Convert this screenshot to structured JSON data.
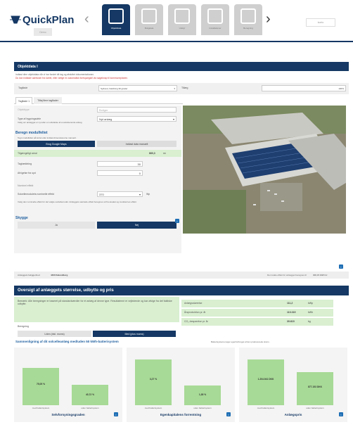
{
  "app": {
    "logo": "QuickPlan",
    "demo_button": "Demo",
    "account_label": "konto"
  },
  "steps": [
    {
      "label": "Objektdata",
      "icon": "house-solar-icon",
      "active": true
    },
    {
      "label": "Boligdata",
      "icon": "house-icon",
      "active": false
    },
    {
      "label": "Udstyr",
      "icon": "calculator-icon",
      "active": false
    },
    {
      "label": "Installationer",
      "icon": "panel-grid-icon",
      "active": false
    },
    {
      "label": "Beregning",
      "icon": "percent-document-icon",
      "active": false
    }
  ],
  "objekt": {
    "title": "Objektdata I",
    "intro": "Indtast dine objektdata når vi har fundet dit tag og afsluttet dokumentationen.",
    "intro2": "Du kan indtaste adressen fra kortet, eller vælge en automatisk forespørgsel via søgeknap til kommuneplanen.",
    "tagflade_label": "Tagflade",
    "tagflade_value": "Sydvest, hældning 30 grader",
    "ekstra_label": "Tillæg",
    "ekstra_value": "100%",
    "tabs": [
      "Tagflade 1",
      "Tilføj flere tagflader"
    ],
    "objekttype_label": "Objekttype",
    "objekttype_value": "Boliger",
    "byg_label": "Type af bygningsdele",
    "byg_value": "Nyt anlæg",
    "byg_hint": "Vælg om anlægget er nyt eller en udvidelse af et eksisterende anlæg",
    "modul_title": "Beregn modulfeltet",
    "modul_hint": "Tegn modulfeltet på kortet eller indtast dimensionerne manuelt.",
    "btn_google": "Brug Google Maps",
    "btn_manuel": "Indtast data manuelt",
    "areal_label": "Tilgængeligt areal",
    "areal_value": "860,3",
    "areal_unit": "m²",
    "taghaeldning_label": "Taghældning",
    "taghaeldning_value": "30",
    "afvigelse_label": "Afvigelse fra syd",
    "afvigelse_value": "0",
    "nominel_title": "Nominel effekt",
    "effekt_label": "Solcellemodulets nominelle effekt",
    "effekt_value": "370",
    "effekt_unit": "Wp",
    "info_text": "Vælg den nominelle effekt for det valgte solcellemodul. Anlæggets samlede effekt beregnes ud fra arealet og modulernes effekt.",
    "skygge_title": "Skygge",
    "skygge_ja": "Ja",
    "skygge_nej": "Nej",
    "adresse_label": "Anlæggets beliggenhed",
    "adresse_value": "4400 Kalundborg",
    "effekt_summary": "Den totale effekt for anlægget beregnes til",
    "effekt_summary_value": "300,15 kWh/m²"
  },
  "oversigt": {
    "title": "Oversigt af anlæggets størrelse, udbytte og pris",
    "bemaerk": "Bemærk: Alle beregninger er baseret på standardværdier for et anlæg af denne type. Resultaterne er vejledende og kan afvige fra det faktiske udbytte.",
    "beregning_label": "Beregning",
    "opt_uden": "Uden (inkl. moms)",
    "opt_med": "Med (plus moms)",
    "rows": [
      {
        "label": "Anlægsstørrelse",
        "value": "111,2",
        "unit": "kWp"
      },
      {
        "label": "Årsproduktion pr. år",
        "value": "110.319",
        "unit": "kWh"
      },
      {
        "label": "CO₂-besparelse pr. år",
        "value": "39.619",
        "unit": "kg"
      }
    ],
    "compare_title": "Sammenligning af dit solcelleanlæg med/uden 50 kWh-batterisystem",
    "compare_note": "Batterisystemet øger egenforbruget af den producerede strøm."
  },
  "chart_data": [
    {
      "type": "bar",
      "title": "Selvforsyningsgraden",
      "categories": [
        "med batterisystem",
        "uden batterisystem"
      ],
      "values": [
        75.05,
        40.72
      ],
      "labels": [
        "75,05 %",
        "40,72 %"
      ],
      "ylim": [
        0,
        100
      ]
    },
    {
      "type": "bar",
      "title": "Egenkapitalens forrentning",
      "categories": [
        "med batterisystem",
        "uden batterisystem"
      ],
      "values": [
        3.27,
        1.38
      ],
      "labels": [
        "3,27 %",
        "1,38 %"
      ],
      "ylim": [
        0,
        3.5
      ]
    },
    {
      "type": "bar",
      "title": "Anlægspris",
      "categories": [
        "med batterisystem",
        "uden batterisystem"
      ],
      "values": [
        1204941,
        877153
      ],
      "labels": [
        "1.204.941 DKK",
        "877.153 DKK"
      ],
      "ylim": [
        0,
        1300000
      ]
    }
  ],
  "colors": {
    "navy": "#153864",
    "green": "#a7da96",
    "lightgreen": "#d9efd0",
    "blue": "#1f6fb5"
  }
}
